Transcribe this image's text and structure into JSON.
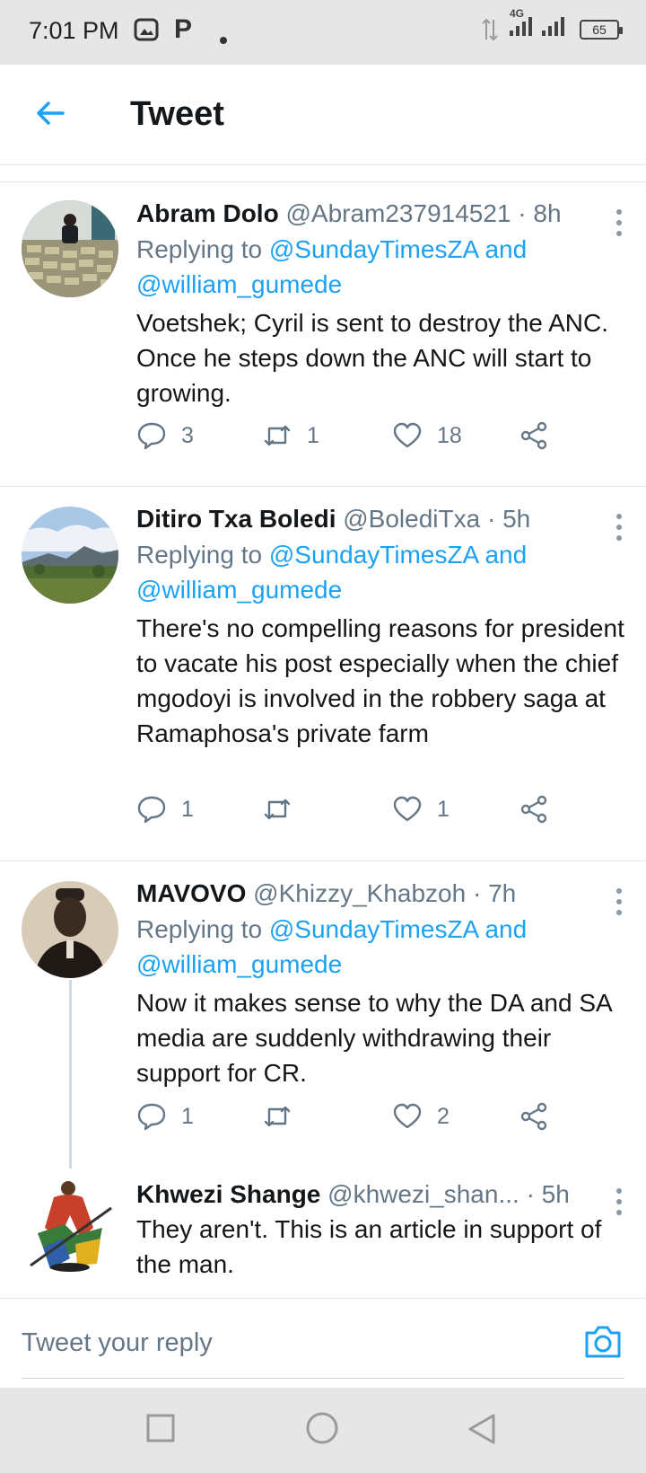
{
  "status_bar": {
    "time": "7:01 PM",
    "notification_icons": [
      "gallery-icon",
      "p-icon",
      "dot-icon"
    ],
    "network": "4G",
    "battery": "65"
  },
  "header": {
    "title": "Tweet",
    "back_icon": "arrow-left-icon",
    "accent": "#1da1f2"
  },
  "tweets": [
    {
      "name": "Abram Dolo",
      "handle": "@Abram237914521",
      "time": "· 8h",
      "replying_prefix": "Replying to",
      "replying_to": "@SundayTimesZA and @william_gumede",
      "text": "Voetshek; Cyril is sent to destroy the ANC. Once he steps down the ANC will start to growing.",
      "replies": "3",
      "retweets": "1",
      "likes": "18"
    },
    {
      "name": "Ditiro Txa Boledi",
      "handle": "@BolediTxa",
      "time": "· 5h",
      "replying_prefix": "Replying to",
      "replying_to": "@SundayTimesZA and @william_gumede",
      "text": "There's no compelling reasons for president to vacate his post especially when the chief mgodoyi is involved in the robbery saga at Ramaphosa's private farm",
      "replies": "1",
      "retweets": "",
      "likes": "1"
    },
    {
      "name": "MAVOVO",
      "handle": "@Khizzy_Khabzoh",
      "time": "· 7h",
      "replying_prefix": "Replying to",
      "replying_to": "@SundayTimesZA and @william_gumede",
      "text": "Now it makes sense to why the DA and SA media are suddenly withdrawing their support for CR.",
      "replies": "1",
      "retweets": "",
      "likes": "2"
    },
    {
      "name": "Khwezi Shange",
      "handle": "@khwezi_shan...",
      "time": "· 5h",
      "text": "They aren't. This is an article in support of the man."
    }
  ],
  "reply_bar": {
    "placeholder": "Tweet your reply",
    "camera_icon": "camera-icon"
  },
  "nav_bar": {
    "buttons": [
      "recents-square-icon",
      "home-circle-icon",
      "back-triangle-icon"
    ]
  }
}
